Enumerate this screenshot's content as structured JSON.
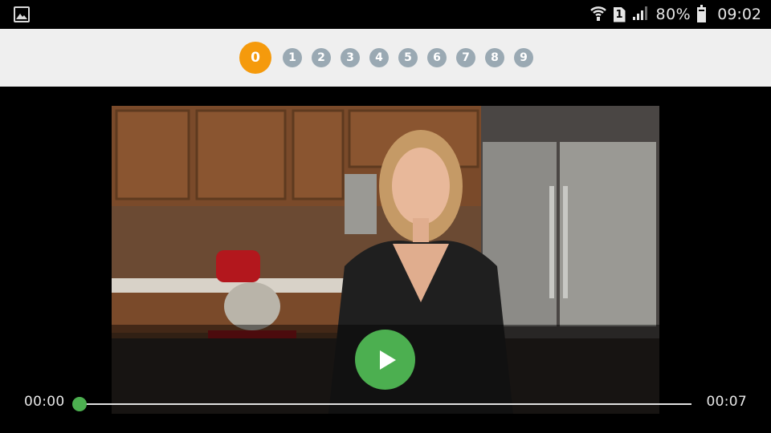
{
  "status_bar": {
    "battery_level": "80%",
    "battery_fraction": 0.8,
    "time": "09:02",
    "sim_label": "1",
    "icons": [
      "gallery-icon",
      "wifi-icon",
      "sim-icon",
      "signal-icon",
      "battery-icon"
    ]
  },
  "pager": {
    "active_index": 0,
    "steps": [
      "0",
      "1",
      "2",
      "3",
      "4",
      "5",
      "6",
      "7",
      "8",
      "9"
    ],
    "active_color": "#f59a0c",
    "inactive_color": "#9aa9b3"
  },
  "player": {
    "current_time": "00:00",
    "duration": "00:07",
    "progress": 0,
    "accent_color": "#4caf50",
    "play_icon": "play-icon"
  }
}
